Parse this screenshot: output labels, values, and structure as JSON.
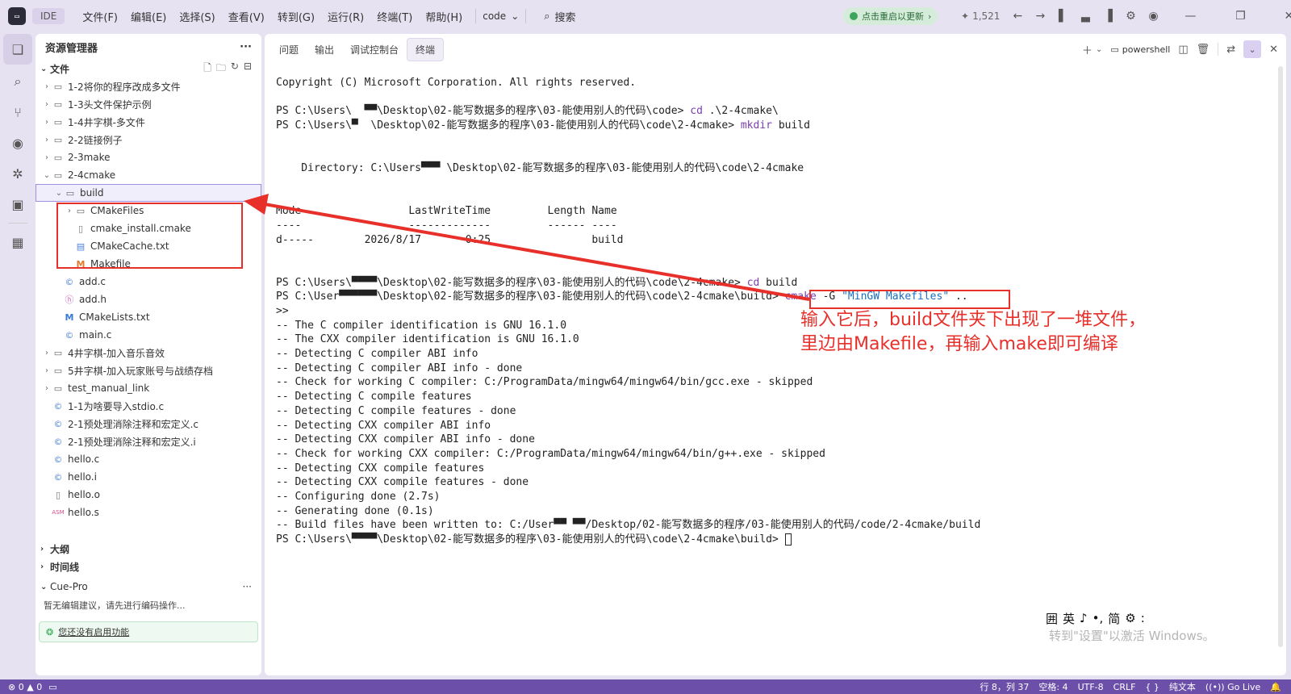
{
  "titlebar": {
    "logo_glyph": "▭",
    "ide_label": "IDE",
    "menu": [
      "文件(F)",
      "编辑(E)",
      "选择(S)",
      "查看(V)",
      "转到(G)",
      "运行(R)",
      "终端(T)",
      "帮助(H)"
    ],
    "code_dropdown": "code",
    "search_label": "搜索",
    "update_label": "点击重启以更新",
    "ports_count": "1,521"
  },
  "sidebar": {
    "title": "资源管理器",
    "files_section": "文件",
    "tree": [
      {
        "indent": 0,
        "chevron": "›",
        "icon": "folder",
        "glyph": "▭",
        "label": "1-2将你的程序改成多文件"
      },
      {
        "indent": 0,
        "chevron": "›",
        "icon": "folder",
        "glyph": "▭",
        "label": "1-3头文件保护示例"
      },
      {
        "indent": 0,
        "chevron": "›",
        "icon": "folder",
        "glyph": "▭",
        "label": "1-4井字棋-多文件"
      },
      {
        "indent": 0,
        "chevron": "›",
        "icon": "folder",
        "glyph": "▭",
        "label": "2-2链接例子"
      },
      {
        "indent": 0,
        "chevron": "›",
        "icon": "folder",
        "glyph": "▭",
        "label": "2-3make"
      },
      {
        "indent": 0,
        "chevron": "⌄",
        "icon": "folder",
        "glyph": "▭",
        "label": "2-4cmake"
      },
      {
        "indent": 1,
        "chevron": "⌄",
        "icon": "folder",
        "glyph": "▭",
        "label": "build",
        "selected": true
      },
      {
        "indent": 2,
        "chevron": "›",
        "icon": "folder",
        "glyph": "▭",
        "label": "CMakeFiles"
      },
      {
        "indent": 2,
        "chevron": "",
        "icon": "file",
        "glyph": "▯",
        "label": "cmake_install.cmake"
      },
      {
        "indent": 2,
        "chevron": "",
        "icon": "txt",
        "glyph": "▤",
        "label": "CMakeCache.txt"
      },
      {
        "indent": 2,
        "chevron": "",
        "icon": "mk",
        "glyph": "M",
        "label": "Makefile"
      },
      {
        "indent": 1,
        "chevron": "",
        "icon": "cfile",
        "glyph": "©",
        "label": "add.c"
      },
      {
        "indent": 1,
        "chevron": "",
        "icon": "hfile",
        "glyph": "ⓗ",
        "label": "add.h"
      },
      {
        "indent": 1,
        "chevron": "",
        "icon": "cm",
        "glyph": "M",
        "label": "CMakeLists.txt"
      },
      {
        "indent": 1,
        "chevron": "",
        "icon": "cfile",
        "glyph": "©",
        "label": "main.c"
      },
      {
        "indent": 0,
        "chevron": "›",
        "icon": "folder",
        "glyph": "▭",
        "label": "4井字棋-加入音乐音效"
      },
      {
        "indent": 0,
        "chevron": "›",
        "icon": "folder",
        "glyph": "▭",
        "label": "5井字棋-加入玩家账号与战绩存档"
      },
      {
        "indent": 0,
        "chevron": "›",
        "icon": "folder",
        "glyph": "▭",
        "label": "test_manual_link"
      },
      {
        "indent": 0,
        "chevron": "",
        "icon": "cfile",
        "glyph": "©",
        "label": "1-1为啥要导入stdio.c"
      },
      {
        "indent": 0,
        "chevron": "",
        "icon": "cfile",
        "glyph": "©",
        "label": "2-1预处理消除注释和宏定义.c"
      },
      {
        "indent": 0,
        "chevron": "",
        "icon": "cfile",
        "glyph": "©",
        "label": "2-1预处理消除注释和宏定义.i"
      },
      {
        "indent": 0,
        "chevron": "",
        "icon": "cfile",
        "glyph": "©",
        "label": "hello.c"
      },
      {
        "indent": 0,
        "chevron": "",
        "icon": "cfile",
        "glyph": "©",
        "label": "hello.i"
      },
      {
        "indent": 0,
        "chevron": "",
        "icon": "file",
        "glyph": "▯",
        "label": "hello.o"
      },
      {
        "indent": 0,
        "chevron": "",
        "icon": "asm",
        "glyph": "ASM",
        "label": "hello.s"
      }
    ],
    "outline_label": "大纲",
    "timeline_label": "时间线",
    "cue_label": "Cue-Pro",
    "cue_message": "暂无编辑建议，请先进行编码操作...",
    "cue_enable": "您还没有启用功能"
  },
  "panel": {
    "tabs": [
      "问题",
      "输出",
      "调试控制台",
      "终端"
    ],
    "active_tab": "终端",
    "shell_label": "powershell",
    "terminal_lines": [
      {
        "t": "Copyright (C) Microsoft Corporation. All rights reserved."
      },
      {
        "t": ""
      },
      {
        "t": "PS C:\\Users\\  ▀▀\\Desktop\\02-能写数据多的程序\\03-能使用别人的代码\\code> ",
        "cmd": "cd",
        "rest": " .\\2-4cmake\\"
      },
      {
        "t": "PS C:\\Users\\▀  \\Desktop\\02-能写数据多的程序\\03-能使用别人的代码\\code\\2-4cmake> ",
        "cmd": "mkdir",
        "rest": " build"
      },
      {
        "t": ""
      },
      {
        "t": ""
      },
      {
        "t": "    Directory: C:\\Users▀▀▀ \\Desktop\\02-能写数据多的程序\\03-能使用别人的代码\\code\\2-4cmake"
      },
      {
        "t": ""
      },
      {
        "t": ""
      },
      {
        "t": "Mode                 LastWriteTime         Length Name"
      },
      {
        "t": "----                 -------------         ------ ----"
      },
      {
        "t": "d-----        2026/8/17       0:25                build"
      },
      {
        "t": ""
      },
      {
        "t": ""
      },
      {
        "t": "PS C:\\Users\\▀▀▀▀\\Desktop\\02-能写数据多的程序\\03-能使用别人的代码\\code\\2-4cmake> ",
        "cmd": "cd",
        "rest": " build"
      },
      {
        "t": "PS C:\\User▀▀▀▀▀▀\\Desktop\\02-能写数据多的程序\\03-能使用别人的代码\\code\\2-4cmake\\build> ",
        "cmd": "cmake",
        "rest": " -G ",
        "str": "\"MinGW Makefiles\"",
        "tail": " .."
      },
      {
        "t": ">>"
      },
      {
        "t": "-- The C compiler identification is GNU 16.1.0"
      },
      {
        "t": "-- The CXX compiler identification is GNU 16.1.0"
      },
      {
        "t": "-- Detecting C compiler ABI info"
      },
      {
        "t": "-- Detecting C compiler ABI info - done"
      },
      {
        "t": "-- Check for working C compiler: C:/ProgramData/mingw64/mingw64/bin/gcc.exe - skipped"
      },
      {
        "t": "-- Detecting C compile features"
      },
      {
        "t": "-- Detecting C compile features - done"
      },
      {
        "t": "-- Detecting CXX compiler ABI info"
      },
      {
        "t": "-- Detecting CXX compiler ABI info - done"
      },
      {
        "t": "-- Check for working CXX compiler: C:/ProgramData/mingw64/mingw64/bin/g++.exe - skipped"
      },
      {
        "t": "-- Detecting CXX compile features"
      },
      {
        "t": "-- Detecting CXX compile features - done"
      },
      {
        "t": "-- Configuring done (2.7s)"
      },
      {
        "t": "-- Generating done (0.1s)"
      },
      {
        "t": "-- Build files have been written to: C:/User▀▀ ▀▀/Desktop/02-能写数据多的程序/03-能使用别人的代码/code/2-4cmake/build"
      },
      {
        "t": "PS C:\\Users\\▀▀▀▀\\Desktop\\02-能写数据多的程序\\03-能使用别人的代码\\code\\2-4cmake\\build> ",
        "cursor": true
      }
    ]
  },
  "annotation": {
    "line1": "输入它后，build文件夹下出现了一堆文件，",
    "line2": "里边由Makefile，再输入make即可编译",
    "color": "#e8302b"
  },
  "watermark": {
    "line1": "激活 Windows",
    "line2": "转到\"设置\"以激活 Windows。"
  },
  "ime": {
    "items": [
      "囲",
      "英",
      "♪",
      "•,",
      "简",
      "⚙",
      ":"
    ]
  },
  "statusbar": {
    "errors": "0",
    "warnings": "0",
    "position": "行 8，列 37",
    "spaces": "空格: 4",
    "encoding": "UTF-8",
    "eol": "CRLF",
    "braces": "{ }",
    "language": "纯文本",
    "golive": "Go Live"
  },
  "colors": {
    "accent": "#6b4fa8",
    "annotation": "#e8302b"
  }
}
